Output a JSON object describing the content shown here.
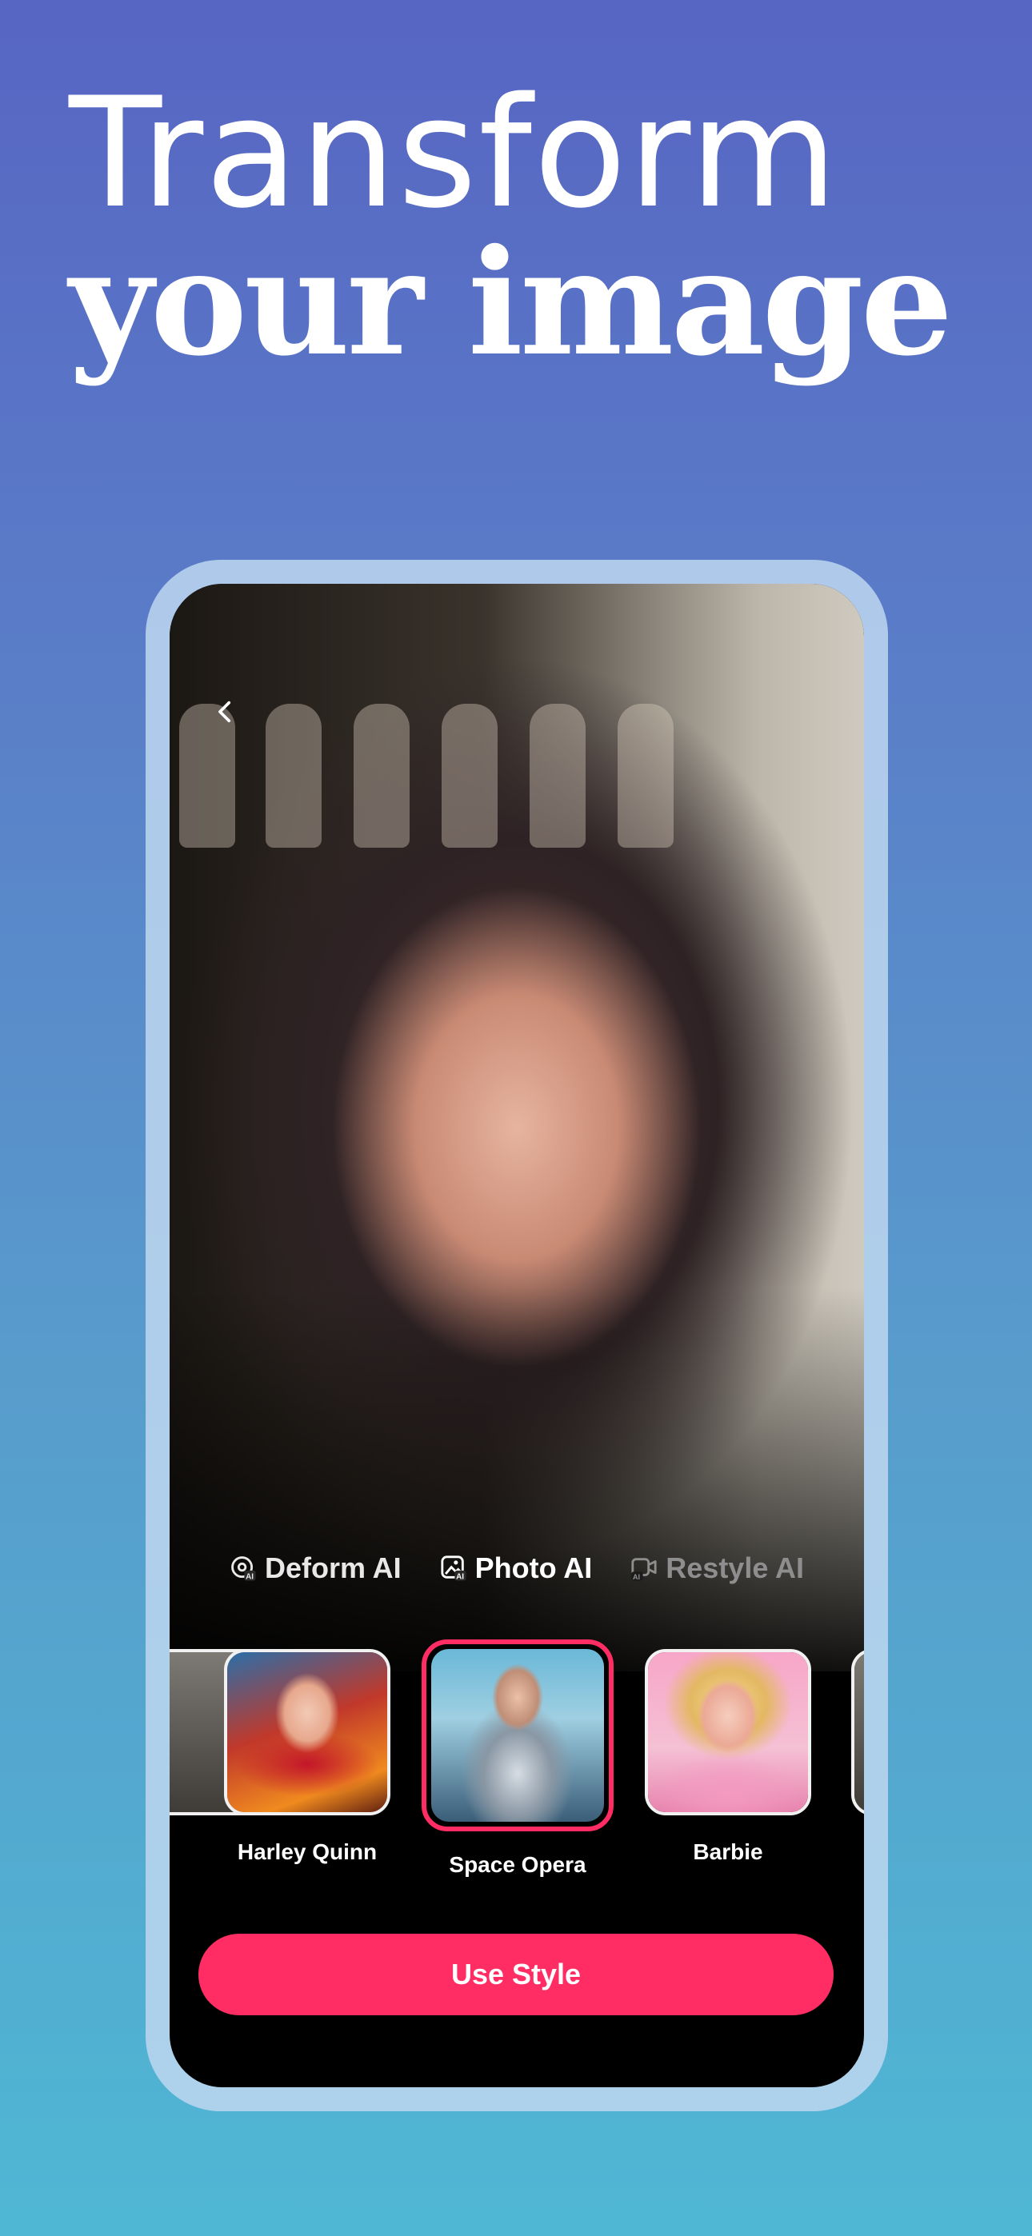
{
  "headline": {
    "line1": "Transform",
    "line2": "your image"
  },
  "phone": {
    "back_icon": "chevron-left-icon",
    "mode_tabs": [
      {
        "label": "Deform AI",
        "icon": "deform-ai-icon",
        "state": "normal"
      },
      {
        "label": "Photo AI",
        "icon": "photo-ai-icon",
        "state": "active"
      },
      {
        "label": "Restyle AI",
        "icon": "restyle-ai-icon",
        "state": "dimmed"
      }
    ],
    "styles": [
      {
        "label": "Harley Quinn",
        "selected": false
      },
      {
        "label": "Space Opera",
        "selected": true
      },
      {
        "label": "Barbie",
        "selected": false
      }
    ],
    "primary_button_label": "Use Style"
  },
  "colors": {
    "accent": "#ff2d63",
    "background_top": "#5765c3",
    "background_bottom": "#4fb7d4",
    "frame": "#bed7f0"
  }
}
